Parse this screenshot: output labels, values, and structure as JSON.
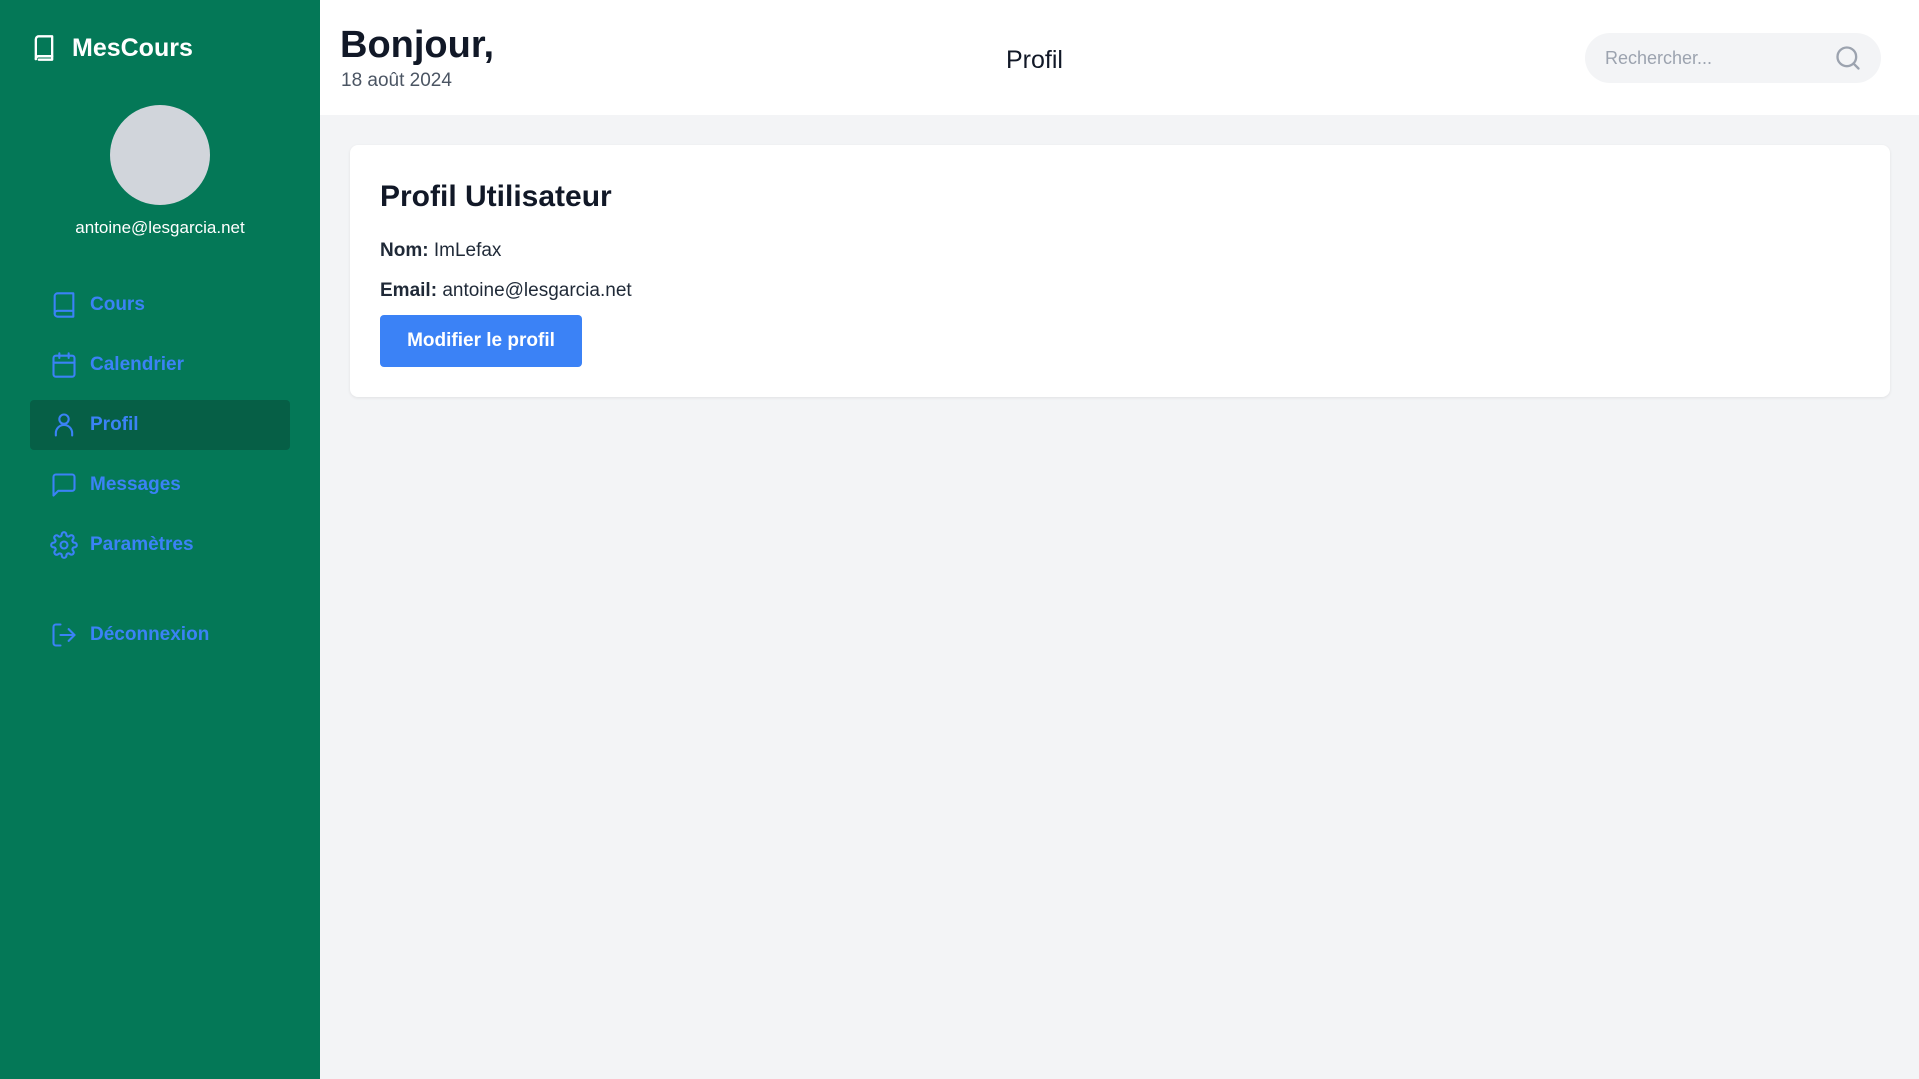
{
  "app": {
    "name": "MesCours",
    "logo_icon": "book-icon"
  },
  "user": {
    "email": "antoine@lesgarcia.net"
  },
  "colors": {
    "sidebar": "#047857",
    "sidebar_active": "#065f46",
    "accent": "#3b82f6"
  },
  "nav": {
    "items": [
      {
        "label": "Cours",
        "icon": "book-icon"
      },
      {
        "label": "Calendrier",
        "icon": "calendar-icon"
      },
      {
        "label": "Profil",
        "icon": "user-icon",
        "active": true
      },
      {
        "label": "Messages",
        "icon": "message-icon"
      },
      {
        "label": "Paramètres",
        "icon": "gear-icon"
      }
    ],
    "logout": {
      "label": "Déconnexion",
      "icon": "logout-icon"
    }
  },
  "header": {
    "greeting": "Bonjour,",
    "date": "18 août 2024",
    "page_title": "Profil",
    "search": {
      "placeholder": "Rechercher...",
      "value": ""
    }
  },
  "profile": {
    "title": "Profil Utilisateur",
    "name_label": "Nom:",
    "name_value": "ImLefax",
    "email_label": "Email:",
    "email_value": "antoine@lesgarcia.net",
    "edit_button": "Modifier le profil"
  }
}
